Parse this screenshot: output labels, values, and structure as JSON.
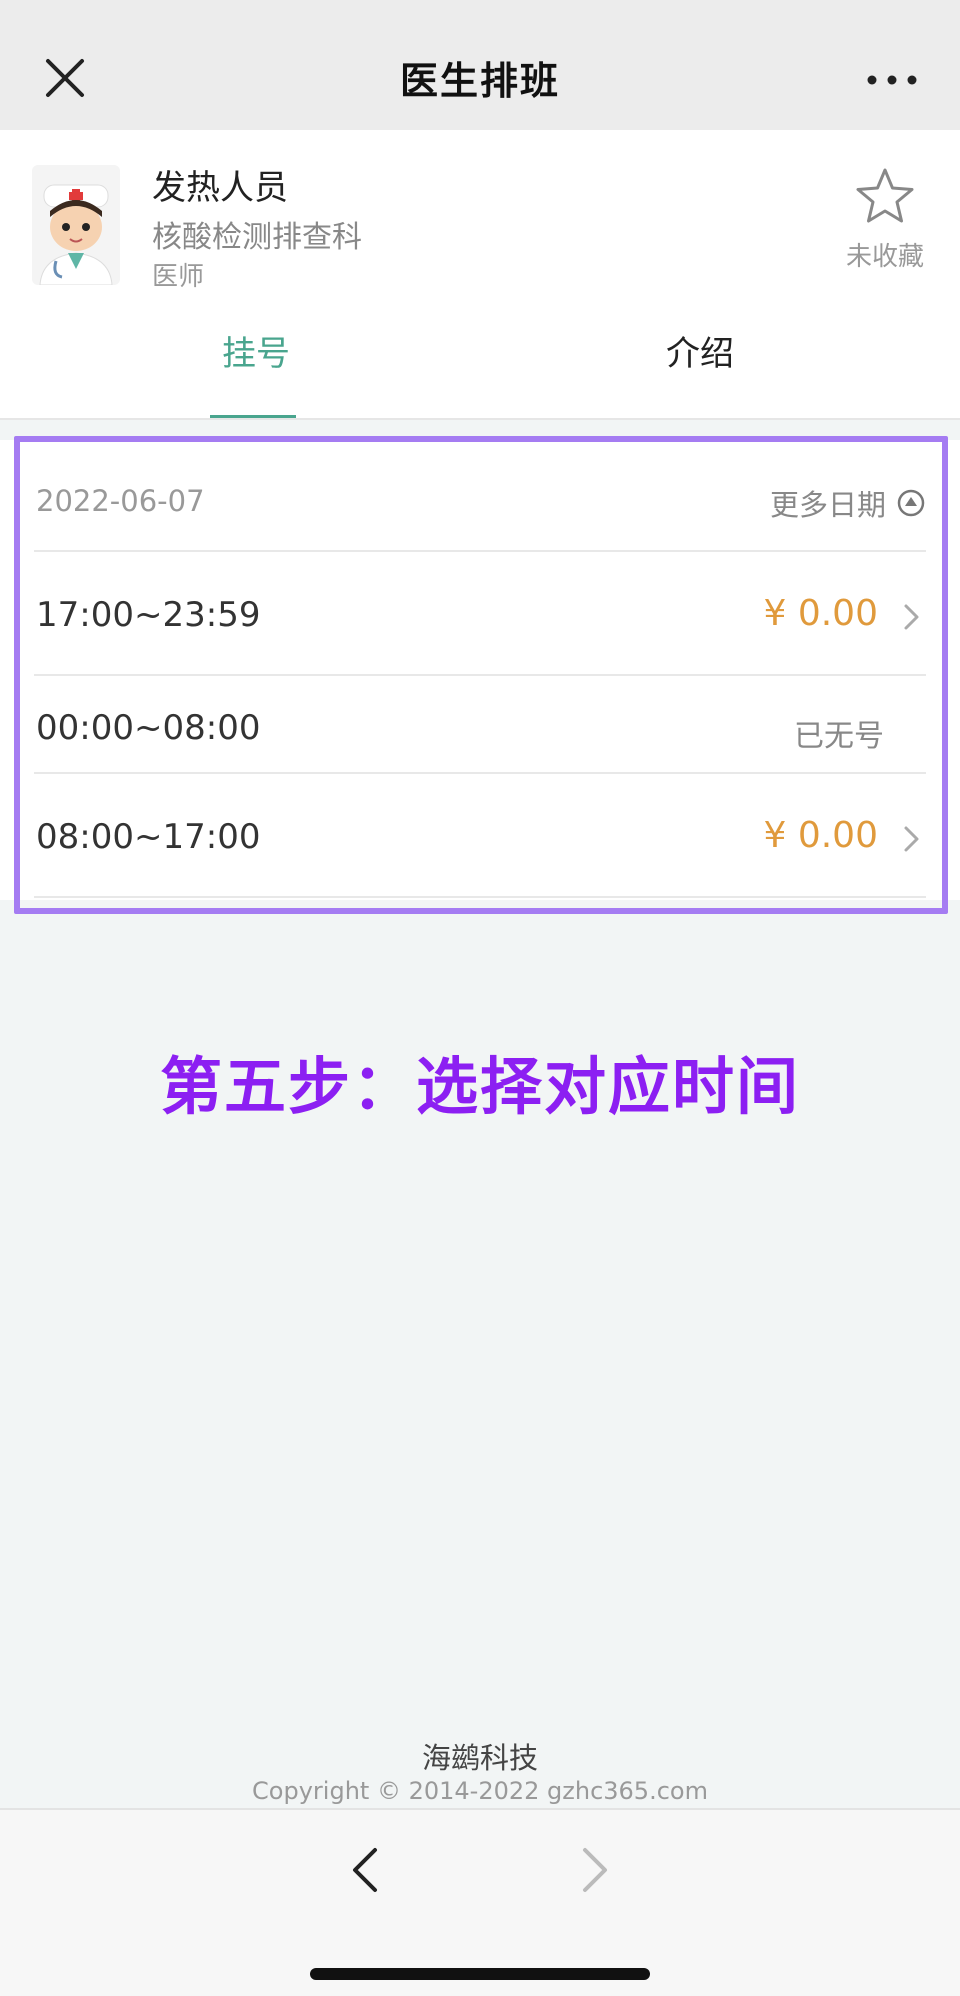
{
  "nav": {
    "title": "医生排班",
    "close_icon": "close-icon",
    "more_icon": "more-icon"
  },
  "doctor": {
    "name": "发热人员",
    "department": "核酸检测排查科",
    "title": "医师",
    "avatar_icon": "doctor-avatar-icon",
    "favorite_label": "未收藏",
    "favorite_icon": "star-outline-icon"
  },
  "tabs": [
    {
      "label": "挂号",
      "active": true
    },
    {
      "label": "介绍",
      "active": false
    }
  ],
  "schedule": {
    "date": "2022-06-07",
    "more_dates_label": "更多日期",
    "slots": [
      {
        "time": "17:00~23:59",
        "price": "¥ 0.00",
        "status": ""
      },
      {
        "time": "00:00~08:00",
        "price": "",
        "status": "已无号"
      },
      {
        "time": "08:00~17:00",
        "price": "¥ 0.00",
        "status": ""
      }
    ]
  },
  "annotation": {
    "text": "第五步：选择对应时间",
    "color": "#8c1ff2",
    "frame_color": "#a57cf2"
  },
  "footer": {
    "brand": "海鹚科技",
    "copyright": "Copyright © 2014-2022 gzhc365.com"
  },
  "colors": {
    "accent": "#49a58e",
    "price": "#e09a3c"
  }
}
